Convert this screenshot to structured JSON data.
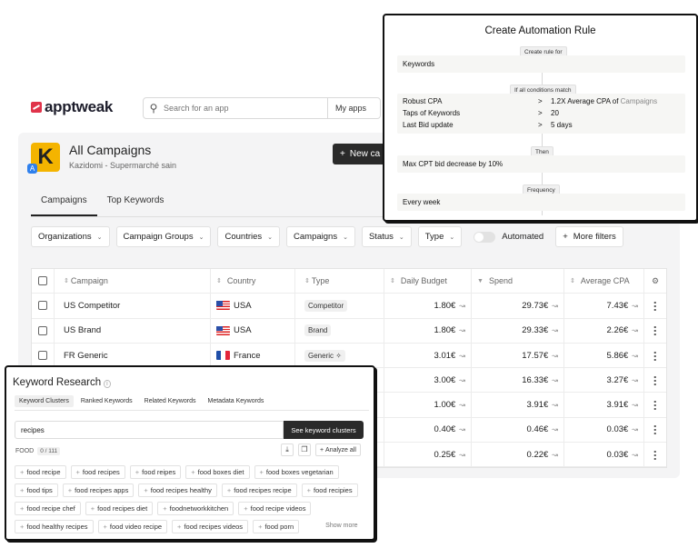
{
  "brand": {
    "name": "apptweak"
  },
  "topbar": {
    "search_placeholder": "Search for an app",
    "my_apps": "My apps"
  },
  "header": {
    "title": "All Campaigns",
    "subtitle": "Kazidomi - Supermarché sain",
    "app_icon_letter": "K",
    "new_campaign": "New ca"
  },
  "tabs": [
    {
      "label": "Campaigns"
    },
    {
      "label": "Top Keywords"
    }
  ],
  "filters": {
    "organizations": "Organizations",
    "campaign_groups": "Campaign Groups",
    "countries": "Countries",
    "campaigns": "Campaigns",
    "status": "Status",
    "type": "Type",
    "automated": "Automated",
    "more_filters": "More filters"
  },
  "table": {
    "headers": {
      "campaign": "Campaign",
      "country": "Country",
      "type": "Type",
      "daily_budget": "Daily Budget",
      "spend": "Spend",
      "avg_cpa": "Average CPA"
    },
    "rows": [
      {
        "name": "US Competitor",
        "country": "USA",
        "type": "Competitor",
        "budget": "1.80€",
        "spend": "29.73€",
        "cpa": "7.43€"
      },
      {
        "name": "US Brand",
        "country": "USA",
        "type": "Brand",
        "budget": "1.80€",
        "spend": "29.33€",
        "cpa": "2.26€"
      },
      {
        "name": "FR Generic",
        "country": "France",
        "type": "Generic",
        "budget": "3.01€",
        "spend": "17.57€",
        "cpa": "5.86€"
      },
      {
        "name": "",
        "country": "",
        "type": "",
        "budget": "3.00€",
        "spend": "16.33€",
        "cpa": "3.27€"
      },
      {
        "name": "",
        "country": "",
        "type": "",
        "budget": "1.00€",
        "spend": "3.91€",
        "cpa": "3.91€"
      },
      {
        "name": "",
        "country": "",
        "type": "",
        "budget": "0.40€",
        "spend": "0.46€",
        "cpa": "0.03€"
      },
      {
        "name": "",
        "country": "",
        "type": "",
        "budget": "0.25€",
        "spend": "0.22€",
        "cpa": "0.03€"
      }
    ]
  },
  "rule": {
    "title": "Create Automation Rule",
    "create_for_chip": "Create rule for",
    "target": "Keywords",
    "conditions_chip": "If all conditions match",
    "conditions": [
      {
        "key": "Robust CPA",
        "op": ">",
        "value": "1.2X Average CPA of",
        "value_muted": "Campaigns"
      },
      {
        "key": "Taps of Keywords",
        "op": ">",
        "value": "20",
        "value_muted": ""
      },
      {
        "key": "Last Bid update",
        "op": ">",
        "value": "5 days",
        "value_muted": ""
      }
    ],
    "then_chip": "Then",
    "action": "Max CPT bid decrease by 10%",
    "frequency_chip": "Frequency",
    "frequency": "Every week"
  },
  "keyword_research": {
    "title": "Keyword Research",
    "info": "i",
    "tabs": [
      "Keyword Clusters",
      "Ranked Keywords",
      "Related Keywords",
      "Metadata Keywords"
    ],
    "search_value": "recipes",
    "search_button": "See keyword clusters",
    "group_label": "FOOD",
    "group_count": "0 / 111",
    "analyze_all": "Analyze all",
    "chips": [
      "food recipe",
      "food recipes",
      "food reipes",
      "food boxes diet",
      "food boxes vegetarian",
      "food tips",
      "food recipes apps",
      "food recipes healthy",
      "food recipes recipe",
      "food recipies",
      "food recipe chef",
      "food recipes diet",
      "foodnetworkkitchen",
      "food recipe videos",
      "food healthy recipes",
      "food video recipe",
      "food recipes videos",
      "food porn"
    ],
    "show_more": "Show more"
  }
}
